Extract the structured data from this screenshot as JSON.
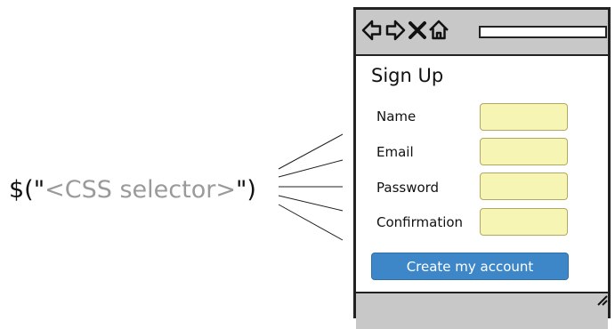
{
  "selector": {
    "prefix": "$(\"",
    "argument": "<CSS selector>",
    "suffix": "\")"
  },
  "browser": {
    "icons": [
      "back-arrow-icon",
      "forward-arrow-icon",
      "close-x-icon",
      "home-icon"
    ],
    "form": {
      "title": "Sign Up",
      "fields": [
        {
          "label": "Name",
          "value": ""
        },
        {
          "label": "Email",
          "value": ""
        },
        {
          "label": "Password",
          "value": ""
        },
        {
          "label": "Confirmation",
          "value": ""
        }
      ],
      "submit_label": "Create my account"
    }
  },
  "colors": {
    "input_fill": "#f7f5b3",
    "input_border": "#b3a860",
    "button_fill": "#3d87c9",
    "chrome_gray": "#c8c8c8",
    "selector_argument": "#9a9a9a"
  }
}
